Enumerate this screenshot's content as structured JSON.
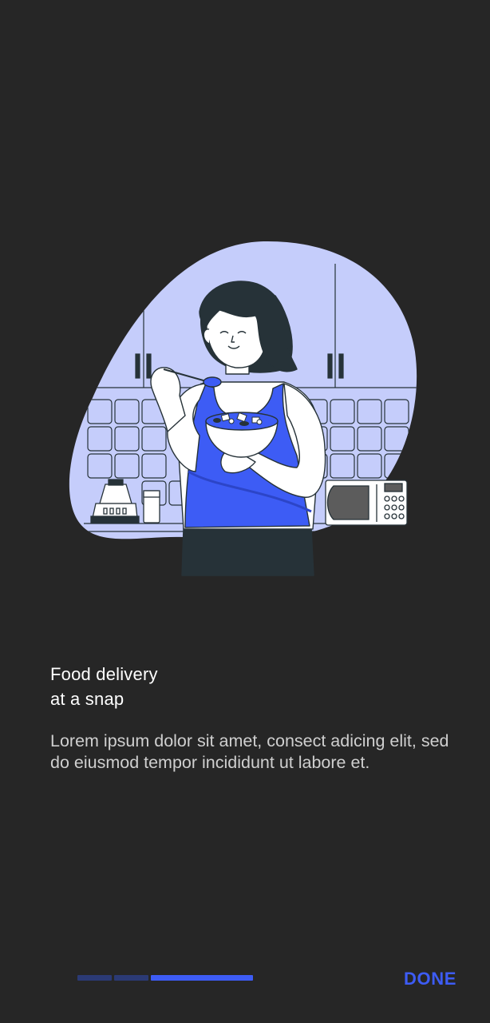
{
  "onboarding": {
    "title_line1": "Food delivery",
    "title_line2": "at a snap",
    "description": "Lorem ipsum dolor sit amet, consect adicing elit, sed do eiusmod tempor incididunt ut labore et.",
    "done_label": "DONE",
    "current_step": 3,
    "total_steps": 3
  },
  "illustration": {
    "icon": "woman-eating-salad-illustration"
  },
  "colors": {
    "background": "#262626",
    "accent": "#3d5cf5",
    "accent_dim": "#2b3a75",
    "blob": "#c5cdfb",
    "text_primary": "#ffffff",
    "text_secondary": "#cfcfcf"
  }
}
